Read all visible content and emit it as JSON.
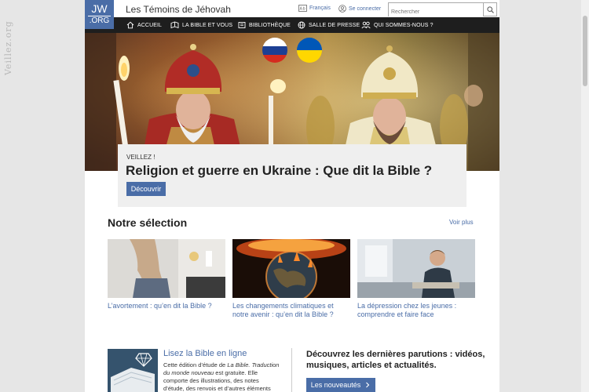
{
  "watermark": "Veillez.org",
  "header": {
    "logo_top": "JW",
    "logo_bottom": ".ORG",
    "logo_reg": "®",
    "site_title": "Les Témoins de Jéhovah",
    "language": "Français",
    "login": "Se connecter",
    "search_placeholder": "Rechercher"
  },
  "nav": {
    "items": [
      {
        "label": "ACCUEIL",
        "icon": "home-icon"
      },
      {
        "label": "LA BIBLE ET VOUS",
        "icon": "bible-icon"
      },
      {
        "label": "BIBLIOTHÈQUE",
        "icon": "library-icon"
      },
      {
        "label": "SALLE DE PRESSE",
        "icon": "globe-icon"
      },
      {
        "label": "QUI SOMMES-NOUS ?",
        "icon": "people-icon"
      }
    ]
  },
  "hero": {
    "kicker": "VEILLEZ !",
    "headline": "Religion et guerre en Ukraine : Que dit la Bible ?",
    "button": "Découvrir",
    "flags": [
      {
        "country": "russia",
        "colors": [
          "#ffffff",
          "#1c3f94",
          "#d52b1e"
        ]
      },
      {
        "country": "ukraine",
        "colors": [
          "#0057b7",
          "#ffd700"
        ]
      }
    ]
  },
  "selection": {
    "title": "Notre sélection",
    "see_more": "Voir plus",
    "cards": [
      {
        "title": "L’avortement : qu’en dit la Bible ?"
      },
      {
        "title": "Les changements climatiques et notre avenir : qu’en dit la Bible ?"
      },
      {
        "title": "La dépression chez les jeunes : comprendre et faire face"
      }
    ]
  },
  "bible_promo": {
    "title": "Lisez la Bible en ligne",
    "desc_1": "Cette édition d’étude de ",
    "desc_italic_1": "La Bible. Traduction du monde nouveau",
    "desc_2": " est gratuite. Elle comporte des illustrations, des notes d’étude, des renvois et d’autres éléments"
  },
  "new_releases": {
    "title": "Découvrez les dernières parutions : vidéos, musiques, articles et actualités.",
    "button": "Les nouveautés"
  },
  "colors": {
    "accent": "#4a6da7",
    "nav_bg": "#1e1e1e",
    "card_bg": "#efefef"
  }
}
